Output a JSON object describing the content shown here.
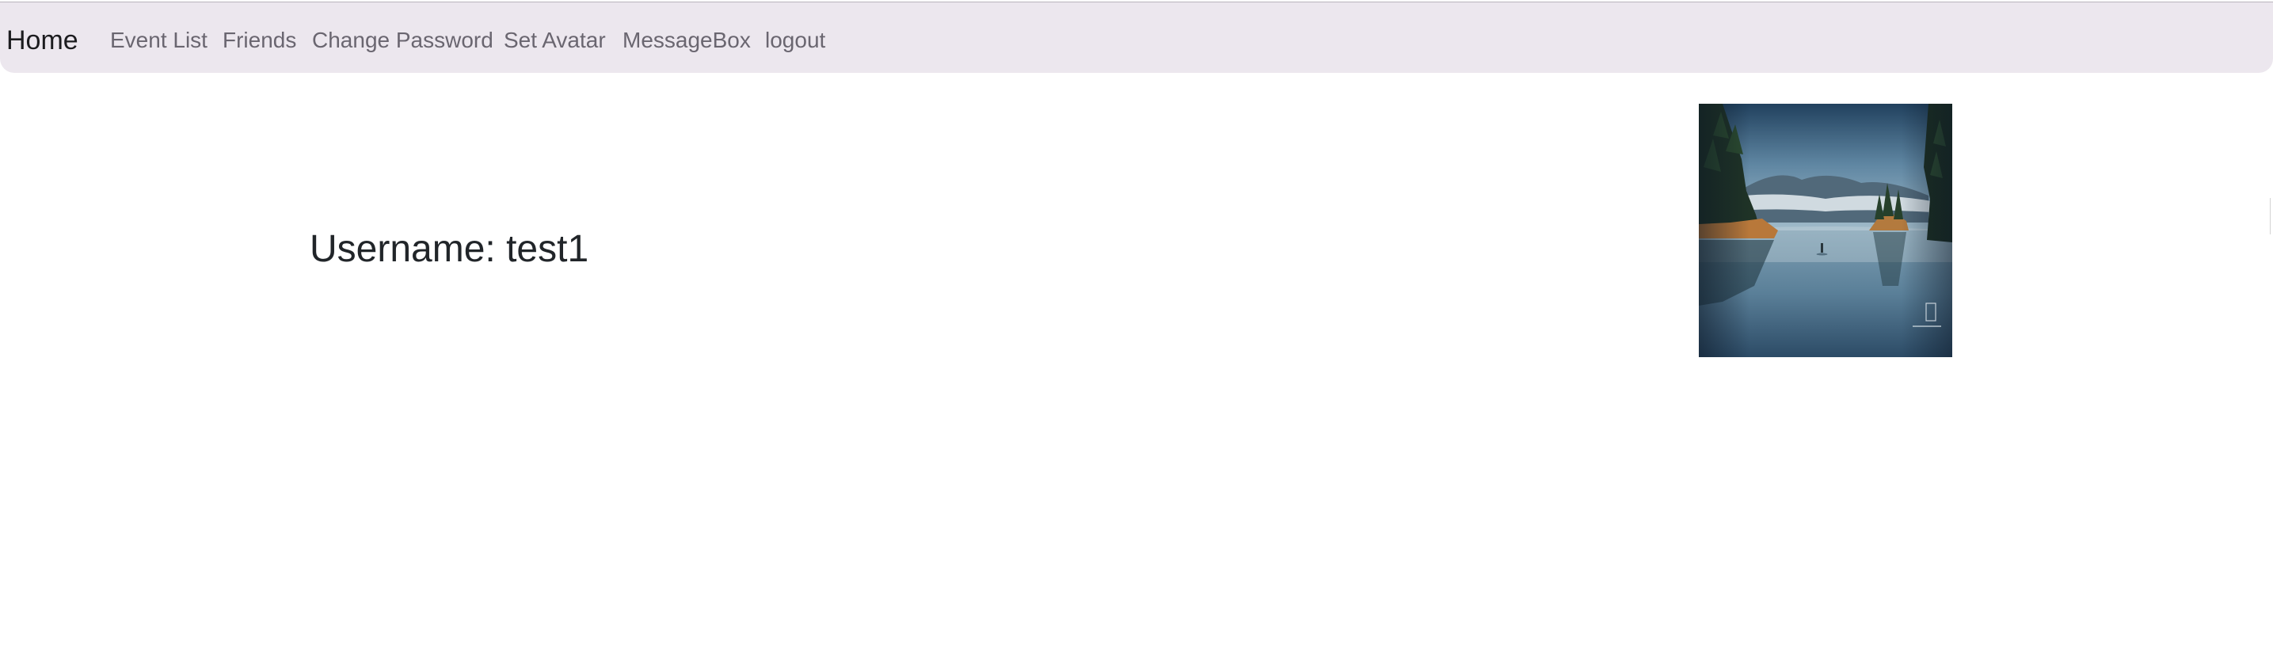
{
  "navbar": {
    "brand": "Home",
    "items": [
      {
        "label": "Event List"
      },
      {
        "label": "Friends"
      },
      {
        "label": "Change Password"
      },
      {
        "label": "Set Avatar"
      },
      {
        "label": "MessageBox"
      },
      {
        "label": "logout"
      }
    ],
    "background_color": "#ece7ee"
  },
  "profile": {
    "username_text": "Username: test1"
  },
  "avatar": {
    "image_name": "lake-landscape-avatar"
  }
}
